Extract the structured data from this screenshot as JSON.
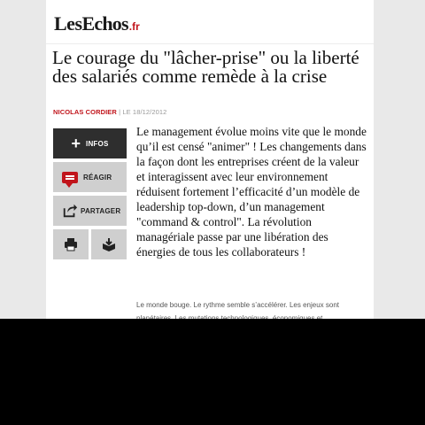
{
  "header": {
    "logo_les": "Les",
    "logo_echos": "Echos",
    "logo_fr": ".fr"
  },
  "article": {
    "title": "Le courage du \"lâcher-prise\" ou la liberté des salariés comme remède à la crise",
    "author": "NICOLAS CORDIER",
    "separator": "|",
    "date": "LE 18/12/2012",
    "lead": "Le management évolue moins vite que le monde qu’il est censé \"animer\" ! Les changements dans la façon dont les entreprises créent de la valeur et interagissent avec leur environnement réduisent fortement l’efficacité d’un modèle de leadership top-down, d’un management \"command & control\". La révolution managériale passe par une libération des énergies de tous les collaborateurs !",
    "body": "Le monde bouge. Le rythme semble s’accélérer. Les enjeux sont planétaires. Les mutations technologiques, économiques et"
  },
  "actions": {
    "infos_label": "INFOS",
    "reagir_label": "RÉAGIR",
    "partager_label": "PARTAGER"
  },
  "icons": {
    "infos": "plus-icon",
    "reagir": "comment-bubble-icon",
    "partager": "share-icon",
    "print": "print-icon",
    "save": "download-box-icon"
  },
  "colors": {
    "brand_red": "#c1141b",
    "infos_bg": "#2e2e2e",
    "button_grey": "#cfcfcf"
  }
}
